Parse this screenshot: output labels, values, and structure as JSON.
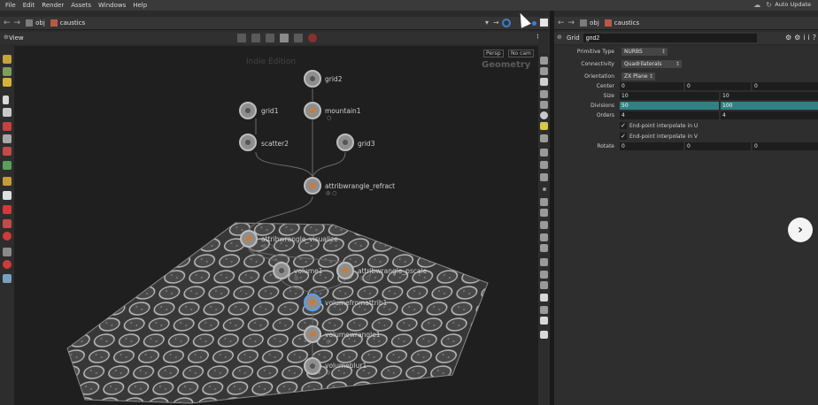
{
  "menubar": {
    "items": [
      "File",
      "Edit",
      "Render",
      "Assets",
      "Windows",
      "Help"
    ],
    "auto_update": "Auto Update"
  },
  "left_path": {
    "segment1": "obj",
    "segment2": "caustics"
  },
  "right_path": {
    "segment1": "obj",
    "segment2": "caustics"
  },
  "viewtab": {
    "label": "View"
  },
  "viewport": {
    "persp": "Persp",
    "nocam": "No cam",
    "geometry_label": "Geometry",
    "ghost_label": "Indie Edition"
  },
  "nodes": [
    {
      "name": "grid2",
      "sub": ""
    },
    {
      "name": "grid1",
      "sub": ""
    },
    {
      "name": "mountain1",
      "sub": "○"
    },
    {
      "name": "scatter2",
      "sub": ""
    },
    {
      "name": "grid3",
      "sub": ""
    },
    {
      "name": "attribwrangle_refract",
      "sub": "◎ ○"
    },
    {
      "name": "attribwrangle_visualize",
      "sub": "◎ ○"
    },
    {
      "name": "volume1",
      "sub": "◎"
    },
    {
      "name": "attribwrangle_pscale",
      "sub": "◎ ○"
    },
    {
      "name": "volumefromattrib1",
      "sub": "◎"
    },
    {
      "name": "volumewrangle1",
      "sub": "◎"
    },
    {
      "name": "volumeblur1",
      "sub": "◎"
    }
  ],
  "params": {
    "node_type": "Grid",
    "node_name": "grid2",
    "primitive_type_label": "Primitive Type",
    "primitive_type_value": "NURBS",
    "connectivity_label": "Connectivity",
    "connectivity_value": "Quadrilaterals",
    "orientation_label": "Orientation",
    "orientation_value": "ZX Plane",
    "center_label": "Center",
    "center": [
      "0",
      "0",
      "0"
    ],
    "size_label": "Size",
    "size": [
      "10",
      "10"
    ],
    "divisions_label": "Divisions",
    "divisions": [
      "50",
      "100"
    ],
    "orders_label": "Orders",
    "orders": [
      "4",
      "4"
    ],
    "endpoint_u": "End-point interpolate in U",
    "endpoint_v": "End-point interpolate in V",
    "check_mark": "✓",
    "rotate_label": "Rotate",
    "rotate": [
      "0",
      "0",
      "0"
    ]
  },
  "fab": {
    "icon": "›"
  },
  "icons": {
    "back": "←",
    "forward": "→",
    "pin": "⌘",
    "help": "?",
    "gear": "⚙",
    "info": "i"
  },
  "colors": {
    "accent_teal": "#2f8184",
    "wrangle_orange": "#d27a2a",
    "selected_blue": "#4fa3ff"
  }
}
